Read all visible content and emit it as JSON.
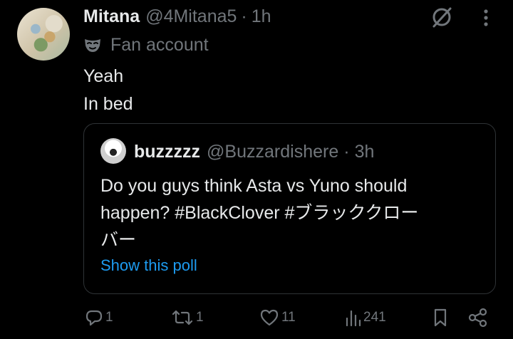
{
  "author": {
    "display_name": "Mitana",
    "handle": "@4Mitana5",
    "separator": "·",
    "time": "1h",
    "label": "Fan account"
  },
  "body": {
    "line1": "Yeah",
    "line2": "In bed"
  },
  "quoted": {
    "display_name": "buzzzzz",
    "handle": "@Buzzardishere",
    "separator": "·",
    "time": "3h",
    "line1": "Do you guys think Asta vs Yuno should",
    "line2": "happen? #BlackClover #ブラッククロー",
    "line3": "バー",
    "link": "Show this poll"
  },
  "actions": {
    "replies": "1",
    "reposts": "1",
    "likes": "11",
    "views": "241"
  },
  "colors": {
    "background": "#000000",
    "text": "#e7e9ea",
    "muted": "#71767b",
    "link": "#1d9bf0",
    "border": "#2f3336"
  },
  "icons": [
    "grok-icon",
    "more-icon",
    "mask-icon",
    "reply-icon",
    "repost-icon",
    "like-icon",
    "views-icon",
    "bookmark-icon",
    "share-icon"
  ]
}
